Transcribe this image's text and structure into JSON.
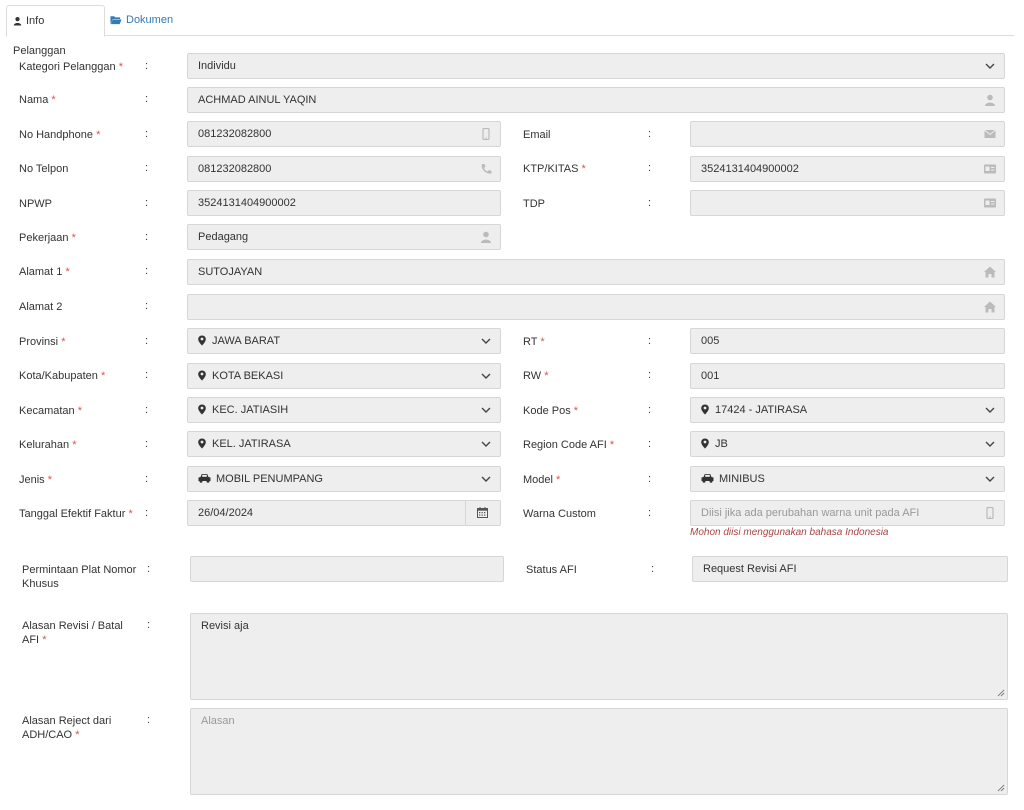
{
  "tabs": [
    {
      "label": "Info Pelanggan",
      "icon": "user-icon",
      "active": true
    },
    {
      "label": "Dokumen",
      "icon": "folder-open-icon",
      "active": false
    }
  ],
  "colon": ":",
  "required_mark": "*",
  "form": {
    "kategori": {
      "label": "Kategori Pelanggan",
      "value": "Individu"
    },
    "nama": {
      "label": "Nama",
      "value": "ACHMAD AINUL YAQIN"
    },
    "no_hp": {
      "label": "No Handphone",
      "value": "081232082800"
    },
    "email": {
      "label": "Email",
      "value": ""
    },
    "no_telpon": {
      "label": "No Telpon",
      "value": "081232082800"
    },
    "ktp": {
      "label": "KTP/KITAS",
      "value": "3524131404900002"
    },
    "npwp": {
      "label": "NPWP",
      "value": "3524131404900002"
    },
    "tdp": {
      "label": "TDP",
      "value": ""
    },
    "pekerjaan": {
      "label": "Pekerjaan",
      "value": "Pedagang"
    },
    "alamat1": {
      "label": "Alamat 1",
      "value": "SUTOJAYAN"
    },
    "alamat2": {
      "label": "Alamat 2",
      "value": ""
    },
    "provinsi": {
      "label": "Provinsi",
      "value": "JAWA BARAT"
    },
    "rt": {
      "label": "RT",
      "value": "005"
    },
    "kota": {
      "label": "Kota/Kabupaten",
      "value": "KOTA BEKASI"
    },
    "rw": {
      "label": "RW",
      "value": "001"
    },
    "kecamatan": {
      "label": "Kecamatan",
      "value": "KEC. JATIASIH"
    },
    "kode_pos": {
      "label": "Kode Pos",
      "value": "17424 - JATIRASA"
    },
    "kelurahan": {
      "label": "Kelurahan",
      "value": "KEL. JATIRASA"
    },
    "region": {
      "label": "Region Code AFI",
      "value": "JB"
    },
    "jenis": {
      "label": "Jenis",
      "value": "MOBIL PENUMPANG"
    },
    "model": {
      "label": "Model",
      "value": "MINIBUS"
    },
    "tanggal": {
      "label": "Tanggal Efektif Faktur",
      "value": "26/04/2024"
    },
    "warna": {
      "label": "Warna Custom",
      "placeholder": "Diisi jika ada perubahan warna unit pada AFI",
      "hint": "Mohon diisi menggunakan bahasa Indonesia"
    },
    "plat": {
      "label_line1": "Permintaan Plat Nomor",
      "label_line2": "Khusus",
      "value": ""
    },
    "status_afi": {
      "label": "Status AFI",
      "value": "Request Revisi AFI"
    },
    "alasan_revisi": {
      "label_line1": "Alasan Revisi / Batal",
      "label_line2": "AFI",
      "value": "Revisi aja"
    },
    "alasan_reject": {
      "label_line1": "Alasan Reject dari",
      "label_line2": "ADH/CAO",
      "placeholder": "Alasan"
    }
  },
  "colors": {
    "field_bg": "#eeeeee",
    "required": "#d9534f",
    "hint": "#a94442",
    "link": "#337ab7"
  }
}
